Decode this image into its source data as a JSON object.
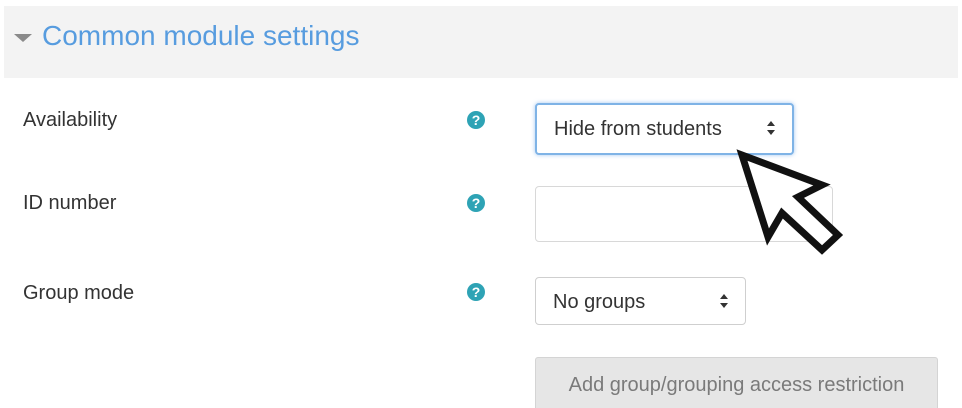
{
  "section": {
    "title": "Common module settings"
  },
  "fields": {
    "availability": {
      "label": "Availability",
      "value": "Hide from students",
      "help_icon": "question-circle-icon"
    },
    "id_number": {
      "label": "ID number",
      "value": "",
      "help_icon": "question-circle-icon"
    },
    "group_mode": {
      "label": "Group mode",
      "value": "No groups",
      "help_icon": "question-circle-icon"
    }
  },
  "buttons": {
    "add_restriction": "Add group/grouping access restriction"
  },
  "colors": {
    "section_title": "#3c8ddc",
    "help_icon": "#2ea3b5",
    "focus_border": "#7fb3e6",
    "header_bg": "#f3f3f3",
    "disabled_button_bg": "#e6e6e6"
  }
}
